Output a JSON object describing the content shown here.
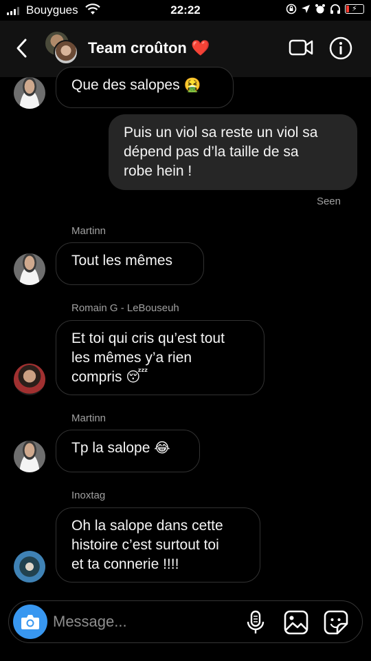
{
  "status_bar": {
    "carrier": "Bouygues",
    "time": "22:22",
    "battery_level": 0.15,
    "battery_color": "#ff3b30"
  },
  "header": {
    "title": "Team croûton",
    "title_emoji": "❤️",
    "back_icon": "chevron-left-icon",
    "video_icon": "video-camera-icon",
    "info_icon": "info-icon"
  },
  "messages": [
    {
      "sender": "",
      "text": "Que des salopes",
      "emoji": "🤮",
      "avatar": "martinn",
      "direction": "in"
    },
    {
      "sender": "",
      "text_lines": [
        "Puis un viol sa reste un viol sa",
        "dépend pas d’la taille de sa",
        "robe hein !"
      ],
      "direction": "out",
      "status": "Seen"
    },
    {
      "sender": "Martinn",
      "text": "Tout les mêmes",
      "avatar": "martinn",
      "direction": "in"
    },
    {
      "sender": "Romain G - LeBouseuh",
      "text_lines": [
        "Et toi qui cris qu’est tout",
        "les mêmes y’a rien",
        "compris"
      ],
      "emoji": "😴",
      "avatar": "romain",
      "direction": "in"
    },
    {
      "sender": "Martinn",
      "text": "Tp la salope",
      "emoji": "😂",
      "avatar": "martinn",
      "direction": "in"
    },
    {
      "sender": "Inoxtag",
      "text_lines": [
        "Oh la salope dans cette",
        "histoire c’est surtout toi",
        "et ta connerie !!!!"
      ],
      "avatar": "inoxtag",
      "direction": "in"
    }
  ],
  "composer": {
    "placeholder": "Message...",
    "camera_icon": "camera-icon",
    "mic_icon": "microphone-icon",
    "gallery_icon": "image-gallery-icon",
    "sticker_icon": "sticker-icon",
    "accent_color": "#3897f0"
  }
}
